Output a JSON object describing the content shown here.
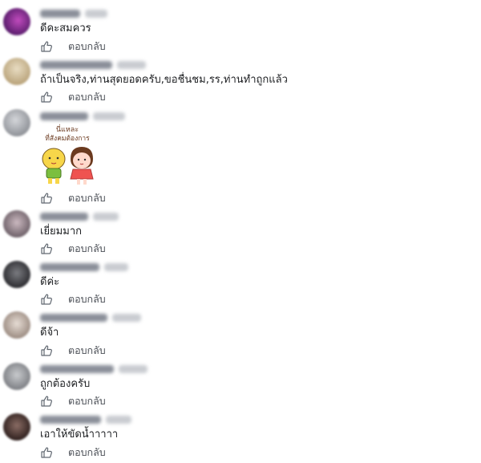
{
  "comments": [
    {
      "text": "ดีคะสมควร",
      "reply_label": "ตอบกลับ",
      "avatar_colors": [
        "#5b1d6e",
        "#c04bbd"
      ]
    },
    {
      "text": "ถ้าเป็นจริง,ท่านสุดยอดครับ,ขอชื่นชม,รร,ท่านทำถูกแล้ว",
      "reply_label": "ตอบกลับ",
      "avatar_colors": [
        "#b9a37a",
        "#e8dcc2"
      ]
    },
    {
      "text": "",
      "reply_label": "ตอบกลับ",
      "avatar_colors": [
        "#8d9096",
        "#d4d6da"
      ],
      "sticker": {
        "caption_line1": "นี่แหละ",
        "caption_line2": "ที่สังคมต้องการ"
      }
    },
    {
      "text": "เยี่ยมมาก",
      "reply_label": "ตอบกลับ",
      "avatar_colors": [
        "#6b5e66",
        "#cbb9c0"
      ]
    },
    {
      "text": "ดีค่ะ",
      "reply_label": "ตอบกลับ",
      "avatar_colors": [
        "#2a2a2e",
        "#7a7b80"
      ]
    },
    {
      "text": "ดีจ้า",
      "reply_label": "ตอบกลับ",
      "avatar_colors": [
        "#9a8a80",
        "#e6dcd4"
      ]
    },
    {
      "text": "ถูกต้องครับ",
      "reply_label": "ตอบกลับ",
      "avatar_colors": [
        "#7b7d82",
        "#c8cacd"
      ]
    },
    {
      "text": "เอาให้ขัดน้ำาาาา",
      "reply_label": "ตอบกลับ",
      "avatar_colors": [
        "#2c1e1c",
        "#8a6c64"
      ]
    }
  ],
  "colors": {
    "text": "#1c1e21",
    "muted": "#4b4f56",
    "icon": "#606770"
  },
  "icons": {
    "like": "thumbs-up-outline"
  }
}
